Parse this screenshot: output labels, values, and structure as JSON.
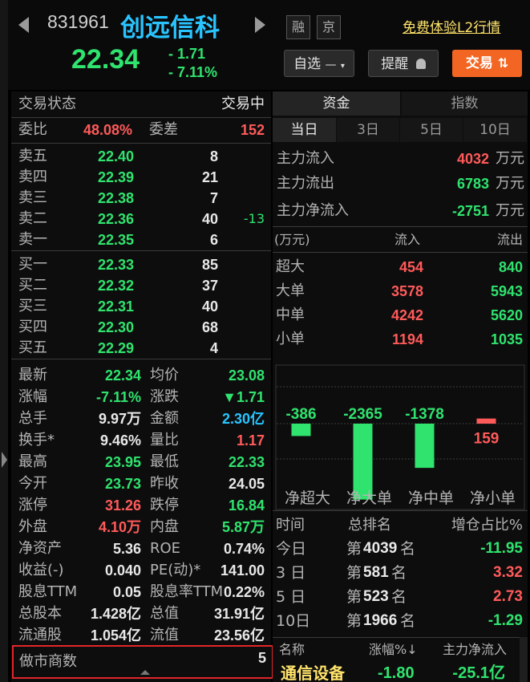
{
  "header": {
    "code": "831961",
    "name": "创远信科",
    "price": "22.34",
    "change": "- 1.71",
    "change_pct": "- 7.11%",
    "tag1": "融",
    "tag2": "京",
    "promo_link": "免费体验L2行情",
    "watchlist_btn": "自选",
    "watchlist_minus": "—",
    "alert_btn": "提醒",
    "trade_btn": "交易"
  },
  "order_book": {
    "status_label": "交易状态",
    "status_value": "交易中",
    "ratio_label": "委比",
    "ratio_value": "48.08%",
    "diff_label": "委差",
    "diff_value": "152",
    "asks": [
      {
        "label": "卖五",
        "price": "22.40",
        "vol": "8",
        "delta": ""
      },
      {
        "label": "卖四",
        "price": "22.39",
        "vol": "21",
        "delta": ""
      },
      {
        "label": "卖三",
        "price": "22.38",
        "vol": "7",
        "delta": ""
      },
      {
        "label": "卖二",
        "price": "22.36",
        "vol": "40",
        "delta": "-13"
      },
      {
        "label": "卖一",
        "price": "22.35",
        "vol": "6",
        "delta": ""
      }
    ],
    "bids": [
      {
        "label": "买一",
        "price": "22.33",
        "vol": "85"
      },
      {
        "label": "买二",
        "price": "22.32",
        "vol": "37"
      },
      {
        "label": "买三",
        "price": "22.31",
        "vol": "40"
      },
      {
        "label": "买四",
        "price": "22.30",
        "vol": "68"
      },
      {
        "label": "买五",
        "price": "22.29",
        "vol": "4"
      }
    ]
  },
  "quote_stats": [
    {
      "l1": "最新",
      "v1": "22.34",
      "c1": "green",
      "l2": "均价",
      "v2": "23.08",
      "c2": "green"
    },
    {
      "l1": "涨幅",
      "v1": "-7.11%",
      "c1": "green",
      "l2": "涨跌",
      "v2": "▼1.71",
      "c2": "green"
    },
    {
      "l1": "总手",
      "v1": "9.97万",
      "c1": "white",
      "l2": "金额",
      "v2": "2.30亿",
      "c2": "cyan"
    },
    {
      "l1": "换手*",
      "v1": "9.46%",
      "c1": "white",
      "l2": "量比",
      "v2": "1.17",
      "c2": "red"
    },
    {
      "l1": "最高",
      "v1": "23.95",
      "c1": "green",
      "l2": "最低",
      "v2": "22.33",
      "c2": "green"
    },
    {
      "l1": "今开",
      "v1": "23.73",
      "c1": "green",
      "l2": "昨收",
      "v2": "24.05",
      "c2": "white"
    },
    {
      "l1": "涨停",
      "v1": "31.26",
      "c1": "red",
      "l2": "跌停",
      "v2": "16.84",
      "c2": "green"
    },
    {
      "l1": "外盘",
      "v1": "4.10万",
      "c1": "red",
      "l2": "内盘",
      "v2": "5.87万",
      "c2": "green"
    },
    {
      "l1": "净资产",
      "v1": "5.36",
      "c1": "white",
      "l2": "ROE",
      "v2": "0.74%",
      "c2": "white"
    },
    {
      "l1": "收益(-)",
      "v1": "0.040",
      "c1": "white",
      "l2": "PE(动)*",
      "v2": "141.00",
      "c2": "white"
    },
    {
      "l1": "股息TTM",
      "v1": "0.05",
      "c1": "white",
      "l2": "股息率TTM",
      "v2": "0.22%",
      "c2": "white"
    },
    {
      "l1": "总股本",
      "v1": "1.428亿",
      "c1": "white",
      "l2": "总值",
      "v2": "31.91亿",
      "c2": "white"
    },
    {
      "l1": "流通股",
      "v1": "1.054亿",
      "c1": "white",
      "l2": "流值",
      "v2": "23.56亿",
      "c2": "white"
    }
  ],
  "market_maker": {
    "label": "做市商数",
    "value": "5"
  },
  "funds": {
    "tab_funds": "资金",
    "tab_index": "指数",
    "periods": [
      "当日",
      "3日",
      "5日",
      "10日"
    ],
    "main_in_label": "主力流入",
    "main_in_value": "4032",
    "main_out_label": "主力流出",
    "main_out_value": "6783",
    "main_net_label": "主力净流入",
    "main_net_value": "-2751",
    "unit": "万元",
    "table_unit": "(万元)",
    "col_in": "流入",
    "col_out": "流出",
    "rows": [
      {
        "label": "超大",
        "in": "454",
        "out": "840"
      },
      {
        "label": "大单",
        "in": "3578",
        "out": "5943"
      },
      {
        "label": "中单",
        "in": "4242",
        "out": "5620"
      },
      {
        "label": "小单",
        "in": "1194",
        "out": "1035"
      }
    ]
  },
  "chart_data": {
    "type": "bar",
    "categories": [
      "净超大",
      "净大单",
      "净中单",
      "净小单"
    ],
    "values": [
      -386,
      -2365,
      -1378,
      159
    ],
    "labels": [
      "-386",
      "-2365",
      "-1378",
      "159"
    ]
  },
  "rank": {
    "h_time": "时间",
    "h_rank": "总排名",
    "h_ratio": "增仓占比%",
    "rows": [
      {
        "t": "今日",
        "pre": "第",
        "n": "4039",
        "suf": "名",
        "v": "-11.95",
        "c": "green"
      },
      {
        "t": "3 日",
        "pre": "第",
        "n": "581",
        "suf": "名",
        "v": "3.32",
        "c": "red"
      },
      {
        "t": "5 日",
        "pre": "第",
        "n": "523",
        "suf": "名",
        "v": "2.73",
        "c": "red"
      },
      {
        "t": "10日",
        "pre": "第",
        "n": "1966",
        "suf": "名",
        "v": "-1.29",
        "c": "green"
      }
    ]
  },
  "sector": {
    "h_name": "名称",
    "h_pct": "涨幅%↓",
    "h_net": "主力净流入",
    "row_name": "通信设备",
    "row_pct": "-1.80",
    "row_net": "-25.1亿"
  },
  "colors": {
    "up": "#ff5a5a",
    "down": "#2fe36e",
    "accent": "#f26522",
    "highlight_box": "#e0252b"
  }
}
